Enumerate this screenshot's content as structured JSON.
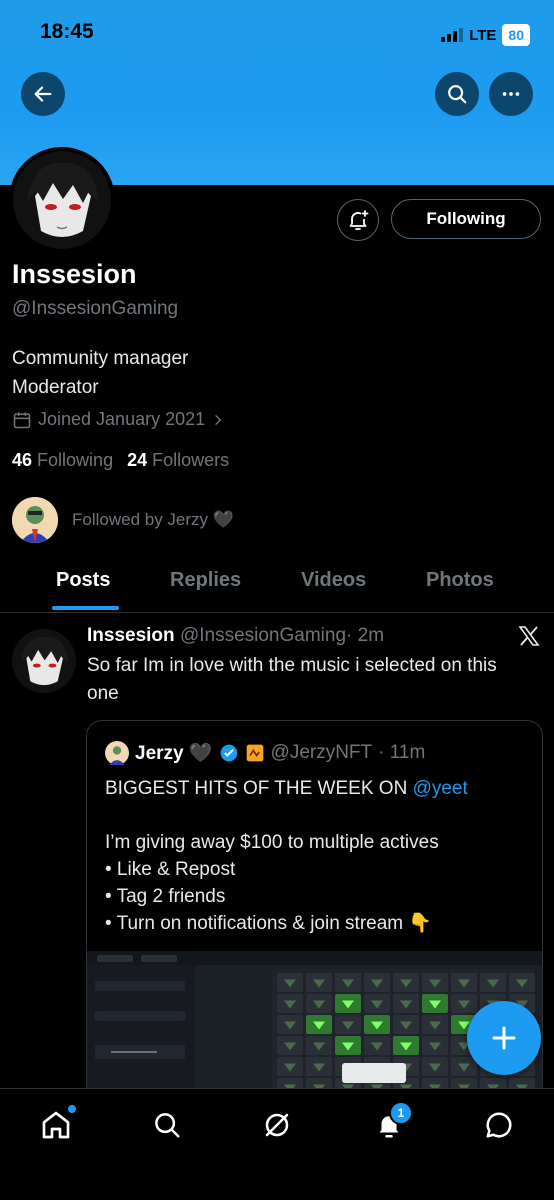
{
  "status_bar": {
    "time": "18:45",
    "network": "LTE",
    "battery": "80"
  },
  "profile": {
    "name": "Inssesion",
    "handle": "@InssesionGaming",
    "bio_line1": "Community manager",
    "bio_line2": "Moderator",
    "joined": "Joined January 2021",
    "following_count": "46",
    "following_label": "Following",
    "followers_count": "24",
    "followers_label": "Followers",
    "followed_by": "Followed by Jerzy 🖤",
    "follow_button": "Following"
  },
  "tabs": [
    "Posts",
    "Replies",
    "Videos",
    "Photos"
  ],
  "tweet": {
    "name": "Inssesion",
    "handle": "@InssesionGaming",
    "time": "· 2m",
    "text": "So far Im in love with the music i selected on this one",
    "quote": {
      "name": "Jerzy 🖤",
      "handle": "@JerzyNFT",
      "time": "· 11m",
      "line1_prefix": "BIGGEST HITS OF THE WEEK ON ",
      "line1_link": "@yeet",
      "line2": "I’m giving away $100 to multiple actives",
      "bullet1": "• Like & Repost",
      "bullet2": "• Tag 2 friends",
      "bullet3": "• Turn on notifications & join stream 👇"
    }
  },
  "nav": {
    "notifications_badge": "1"
  },
  "colors": {
    "accent": "#1d9bf0",
    "background": "#000000",
    "muted": "#71767b"
  }
}
